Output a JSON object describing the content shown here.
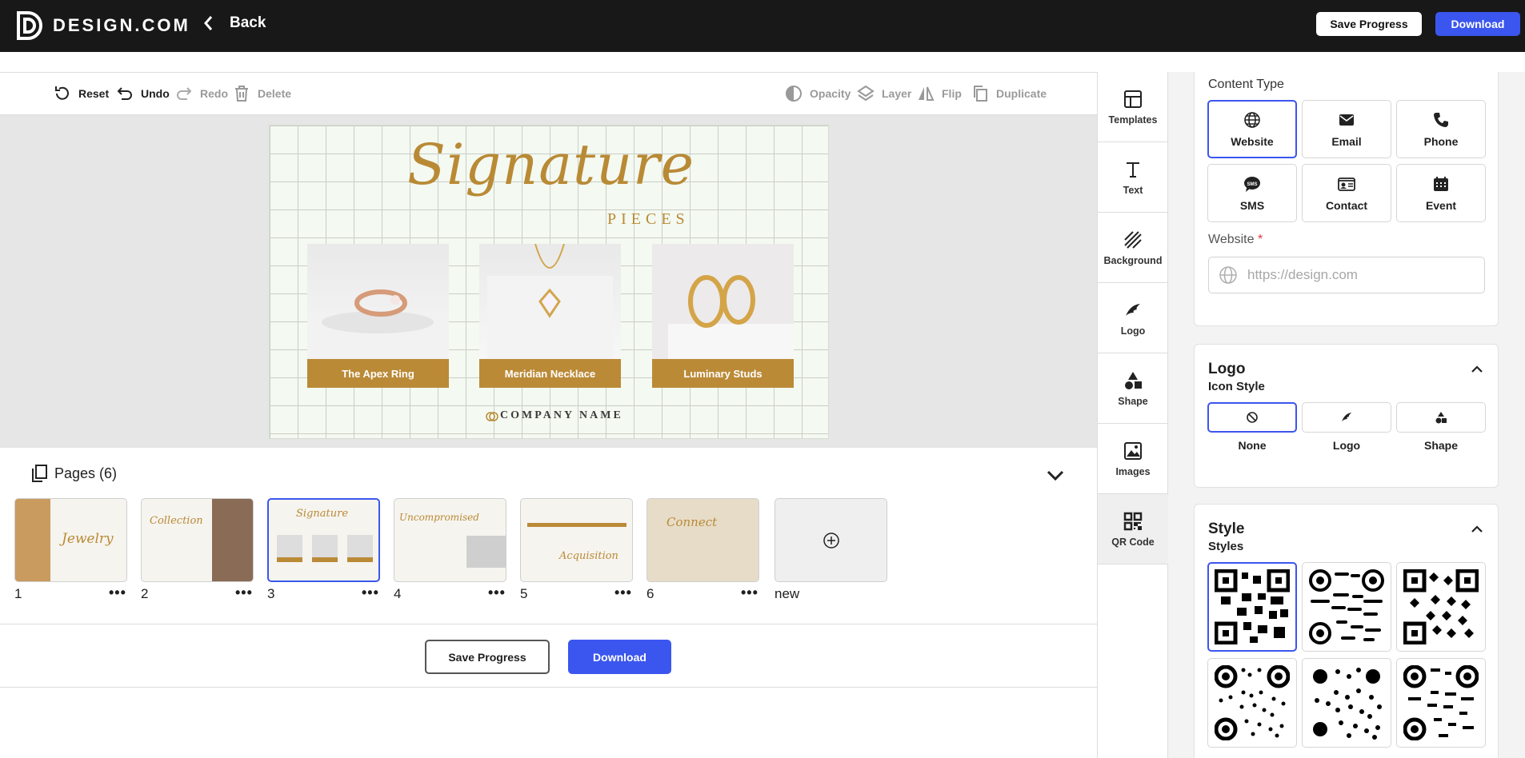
{
  "brand": {
    "name": "DESIGN.COM"
  },
  "header": {
    "back_label": "Back",
    "save_label": "Save Progress",
    "download_label": "Download"
  },
  "toolbar": {
    "reset": "Reset",
    "undo": "Undo",
    "redo": "Redo",
    "delete": "Delete",
    "opacity": "Opacity",
    "layer": "Layer",
    "flip": "Flip",
    "duplicate": "Duplicate"
  },
  "artboard": {
    "title": "Signature",
    "subtitle": "PIECES",
    "products": [
      {
        "label": "The Apex Ring"
      },
      {
        "label": "Meridian Necklace"
      },
      {
        "label": "Luminary Studs"
      }
    ],
    "company": "COMPANY NAME"
  },
  "pages": {
    "heading": "Pages (6)",
    "items": [
      {
        "num": "1",
        "thumb_text": "Jewelry"
      },
      {
        "num": "2",
        "thumb_text": "Collection"
      },
      {
        "num": "3",
        "thumb_text": "Signature"
      },
      {
        "num": "4",
        "thumb_text": "Uncompromised"
      },
      {
        "num": "5",
        "thumb_text": "Acquisition"
      },
      {
        "num": "6",
        "thumb_text": "Connect"
      }
    ],
    "more": "•••",
    "new_label": "new"
  },
  "footer": {
    "save_label": "Save Progress",
    "download_label": "Download"
  },
  "side_tabs": [
    "Templates",
    "Text",
    "Background",
    "Logo",
    "Shape",
    "Images",
    "QR Code"
  ],
  "panel": {
    "content_type": {
      "heading": "Content Type",
      "options": [
        "Website",
        "Email",
        "Phone",
        "SMS",
        "Contact",
        "Event"
      ],
      "selected": "Website"
    },
    "website": {
      "label": "Website",
      "required_mark": "*",
      "placeholder": "https://design.com",
      "value": ""
    },
    "logo": {
      "title": "Logo",
      "icon_style_label": "Icon Style",
      "options": [
        "None",
        "Logo",
        "Shape"
      ],
      "selected": "None"
    },
    "style": {
      "title": "Style",
      "styles_label": "Styles",
      "selected_index": 0
    }
  },
  "colors": {
    "accent": "#3b56ee",
    "gold": "#bb8a37",
    "topbar": "#181818"
  }
}
